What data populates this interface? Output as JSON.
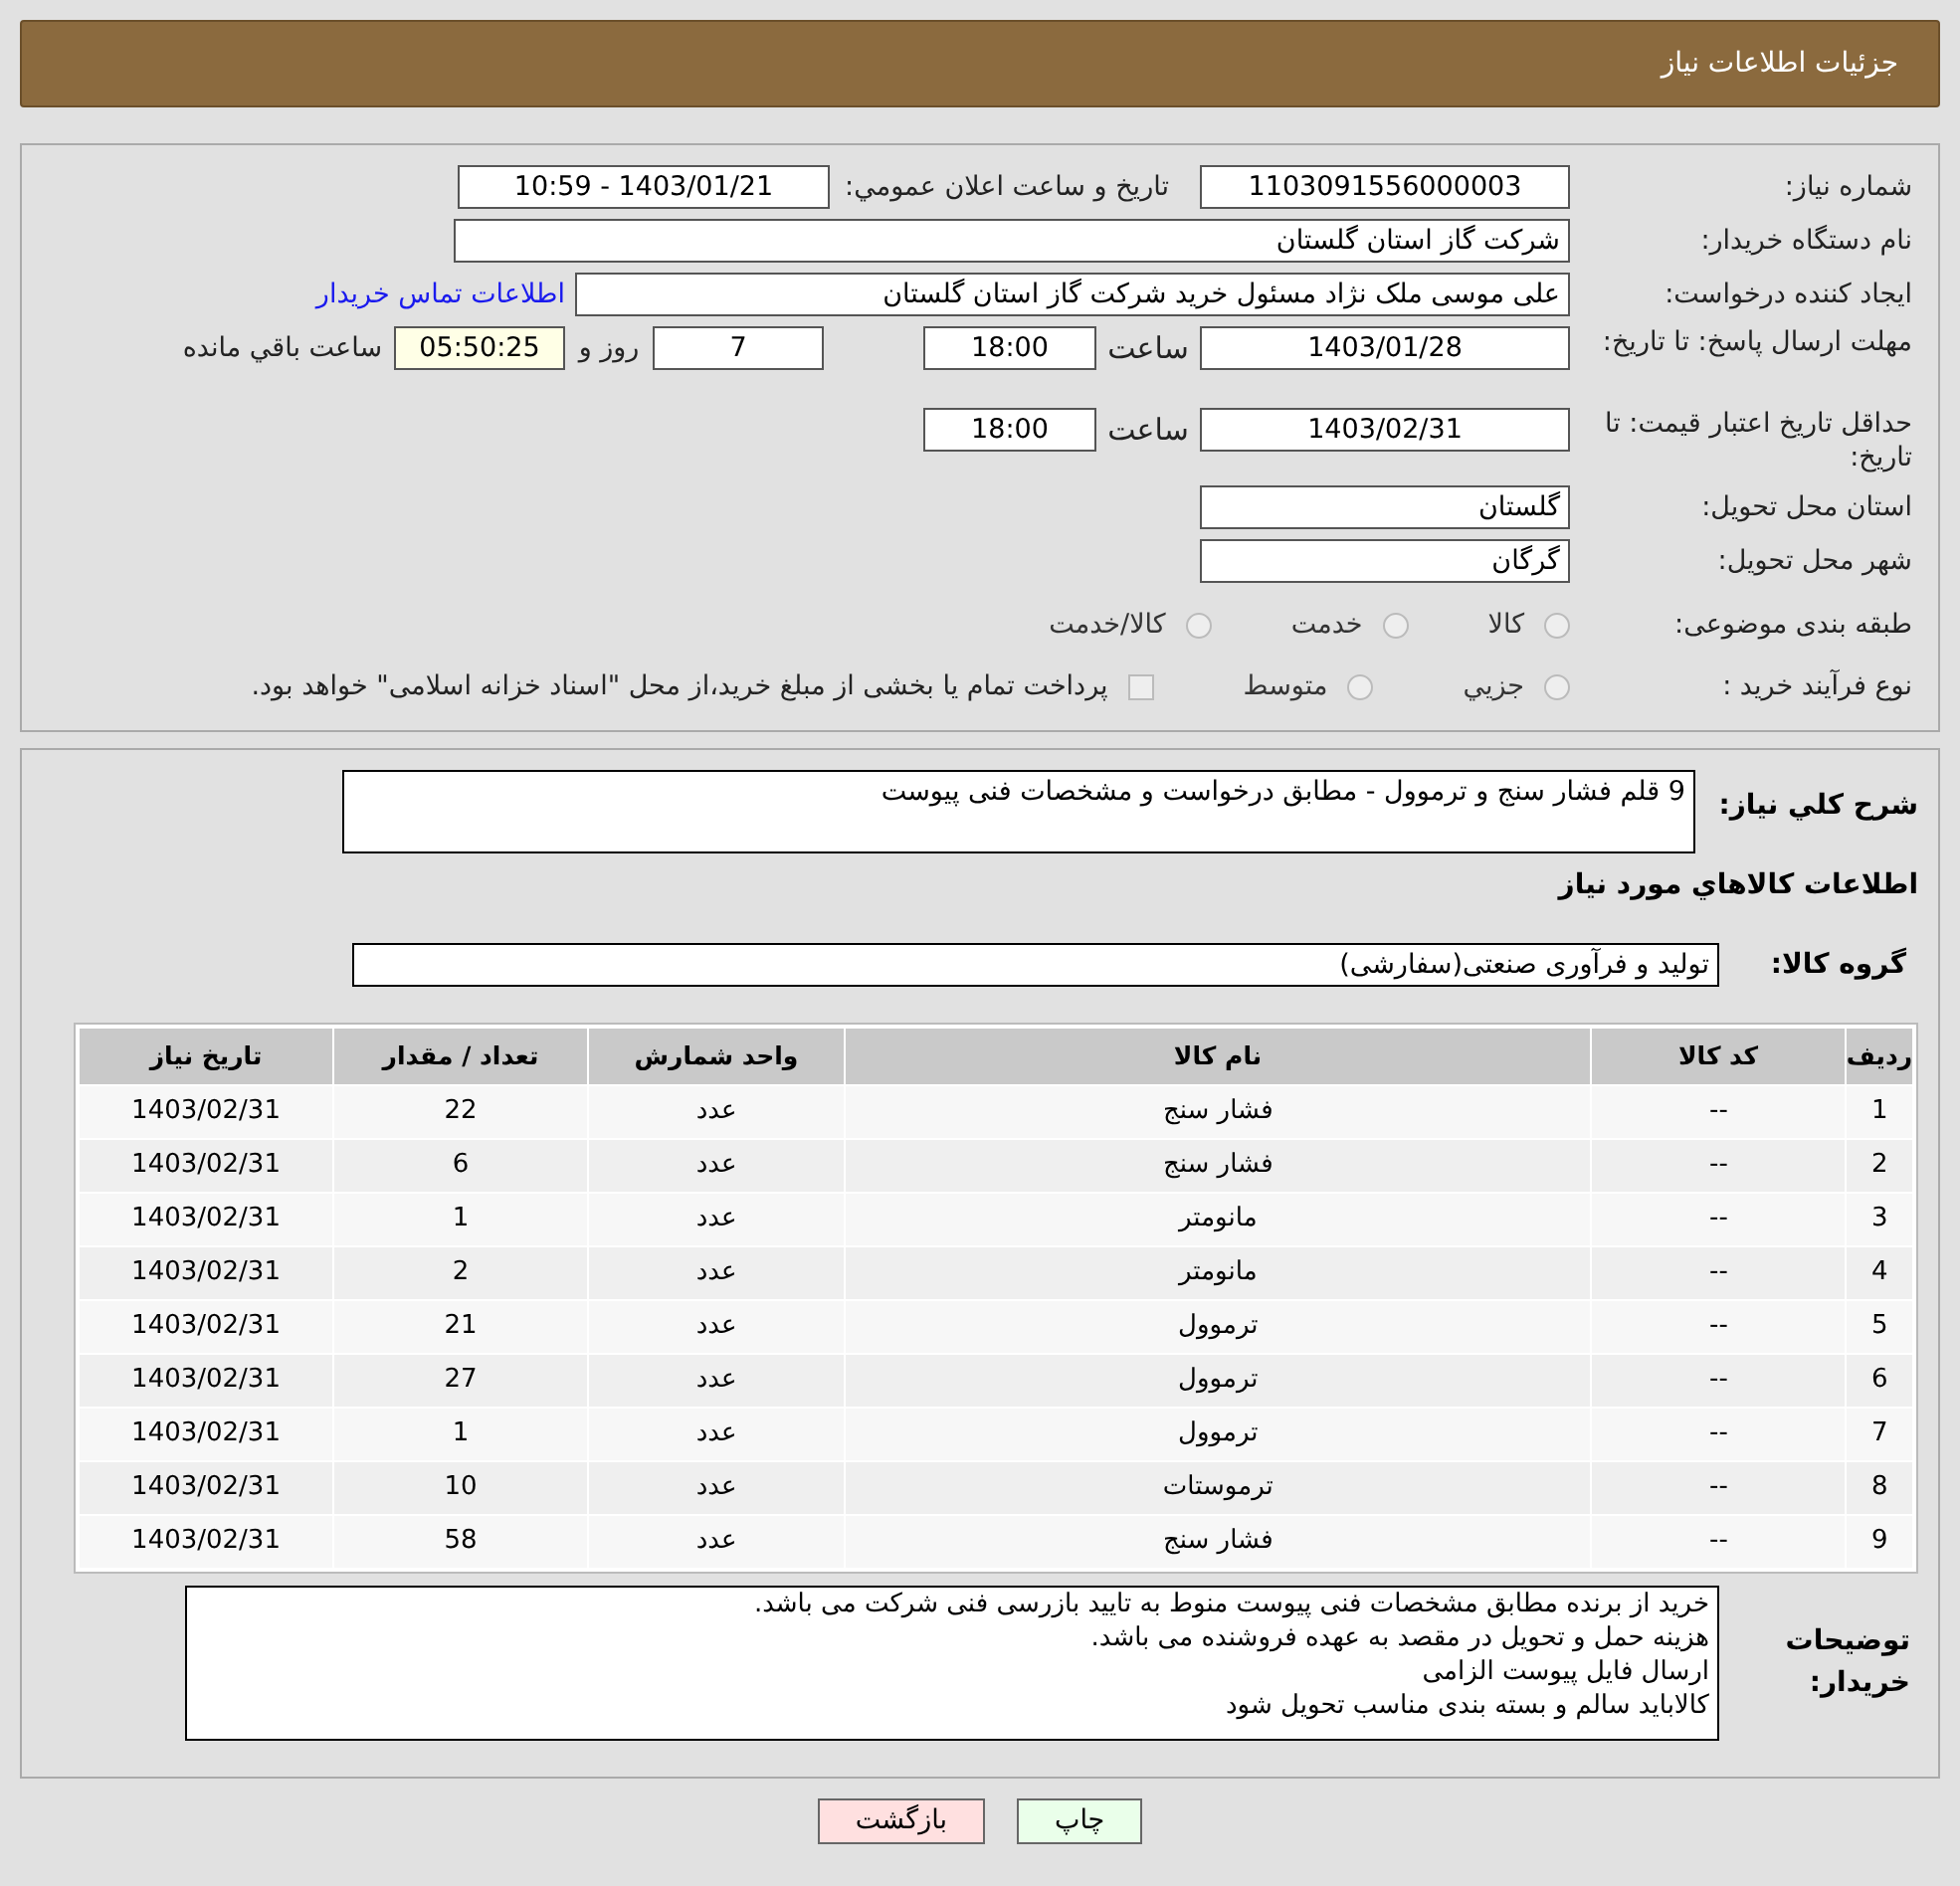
{
  "header": {
    "title": "جزئیات اطلاعات نیاز"
  },
  "details": {
    "need_number": {
      "label": "شماره نیاز:",
      "value": "1103091556000003"
    },
    "announce": {
      "label": "تاریخ و ساعت اعلان عمومي:",
      "value": "1403/01/21 - 10:59"
    },
    "buyer_org": {
      "label": "نام دستگاه خریدار:",
      "value": "شرکت گاز استان گلستان"
    },
    "requester": {
      "label": "ایجاد کننده درخواست:",
      "value": "علی موسی ملک نژاد مسئول خرید شرکت گاز استان گلستان",
      "link": "اطلاعات تماس خریدار"
    },
    "deadline": {
      "label": "مهلت ارسال پاسخ: تا تاریخ:",
      "date": "1403/01/28",
      "time_label": "ساعت",
      "time": "18:00",
      "days": "7",
      "days_label": "روز و",
      "remaining": "05:50:25",
      "remaining_label": "ساعت باقي مانده"
    },
    "validity": {
      "label": "حداقل تاریخ اعتبار قیمت: تا تاریخ:",
      "date": "1403/02/31",
      "time_label": "ساعت",
      "time": "18:00"
    },
    "province": {
      "label": "استان محل تحویل:",
      "value": "گلستان"
    },
    "city": {
      "label": "شهر محل تحویل:",
      "value": "گرگان"
    },
    "category": {
      "label": "طبقه بندی موضوعی:",
      "options": [
        {
          "label": "کالا",
          "selected": false
        },
        {
          "label": "خدمت",
          "selected": false
        },
        {
          "label": "کالا/خدمت",
          "selected": false
        }
      ]
    },
    "process": {
      "label": "نوع فرآیند خرید :",
      "options": [
        {
          "label": "جزيي",
          "selected": false
        },
        {
          "label": "متوسط",
          "selected": false
        }
      ],
      "payment": {
        "label": "پرداخت تمام یا بخشی از مبلغ خرید،از محل \"اسناد خزانه اسلامی\" خواهد بود.",
        "checked": false
      }
    }
  },
  "summary": {
    "label": "شرح کلي نياز:",
    "value": "9 قلم فشار سنج و ترموول - مطابق درخواست و مشخصات فنی پیوست"
  },
  "goods_title": "اطلاعات کالاهاي مورد نياز",
  "goods_group": {
    "label": "گروه کالا:",
    "value": "تولید و فرآوری صنعتی(سفارشی)"
  },
  "table": {
    "columns": [
      "ردیف",
      "کد کالا",
      "نام کالا",
      "واحد شمارش",
      "تعداد / مقدار",
      "تاریخ نیاز"
    ],
    "rows": [
      [
        "1",
        "--",
        "فشار سنج",
        "عدد",
        "22",
        "1403/02/31"
      ],
      [
        "2",
        "--",
        "فشار سنج",
        "عدد",
        "6",
        "1403/02/31"
      ],
      [
        "3",
        "--",
        "مانومتر",
        "عدد",
        "1",
        "1403/02/31"
      ],
      [
        "4",
        "--",
        "مانومتر",
        "عدد",
        "2",
        "1403/02/31"
      ],
      [
        "5",
        "--",
        "ترموول",
        "عدد",
        "21",
        "1403/02/31"
      ],
      [
        "6",
        "--",
        "ترموول",
        "عدد",
        "27",
        "1403/02/31"
      ],
      [
        "7",
        "--",
        "ترموول",
        "عدد",
        "1",
        "1403/02/31"
      ],
      [
        "8",
        "--",
        "ترموستات",
        "عدد",
        "10",
        "1403/02/31"
      ],
      [
        "9",
        "--",
        "فشار سنج",
        "عدد",
        "58",
        "1403/02/31"
      ]
    ]
  },
  "buyer_notes": {
    "label": "توضیحات خریدار:",
    "lines": [
      "خرید از برنده مطابق مشخصات فنی پیوست منوط به تایید بازرسی فنی شرکت می باشد.",
      "هزینه حمل و تحویل در مقصد به عهده فروشنده می باشد.",
      "ارسال فایل پیوست الزامی",
      "کالاباید سالم و بسته بندی مناسب تحویل شود"
    ]
  },
  "buttons": [
    {
      "kind": "print",
      "label": "چاپ"
    },
    {
      "kind": "back",
      "label": "بازگشت"
    }
  ]
}
